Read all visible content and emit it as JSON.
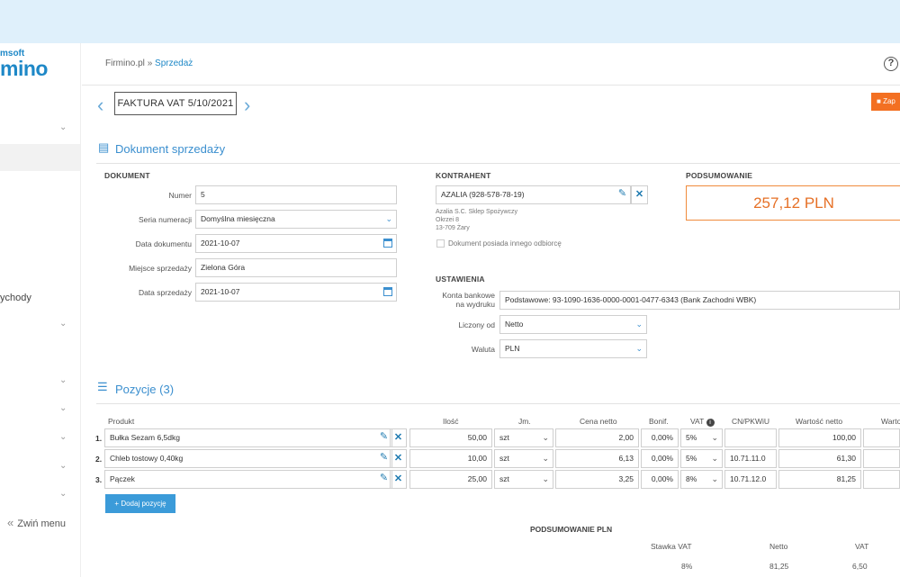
{
  "brand": {
    "small": "msoft",
    "big": "mino"
  },
  "sidebar": {
    "collapse_label": "Zwiń menu",
    "visible_label": "ychody",
    "collapse_icon": "double-chevron-left-icon"
  },
  "breadcrumb": {
    "home": "Firmino.pl",
    "sep": "»",
    "current": "Sprzedaż"
  },
  "help": "?",
  "document": {
    "title": "FAKTURA VAT 5/10/2021",
    "save_label": "Zap"
  },
  "section_doc": {
    "title": "Dokument sprzedaży"
  },
  "dokument": {
    "heading": "DOKUMENT",
    "fields": [
      {
        "label": "Numer",
        "value": "5"
      },
      {
        "label": "Seria numeracji",
        "value": "Domyślna miesięczna"
      },
      {
        "label": "Data dokumentu",
        "value": "2021-10-07"
      },
      {
        "label": "Miejsce sprzedaży",
        "value": "Zielona Góra"
      },
      {
        "label": "Data sprzedaży",
        "value": "2021-10-07"
      }
    ]
  },
  "kontrahent": {
    "heading": "KONTRAHENT",
    "value": "AZALIA (928-578-78-19)",
    "address": [
      "Azalia S.C. Sklep Spożywczy",
      "Okrzei 8",
      "13-709 Żary"
    ],
    "other_recipient": "Dokument posiada innego odbiorcę"
  },
  "ustawienia": {
    "heading": "USTAWIENIA",
    "bank_label_1": "Konta bankowe",
    "bank_label_2": "na wydruku",
    "bank_value": "Podstawowe: 93-1090-1636-0000-0001-0477-6343 (Bank Zachodni WBK)",
    "liczony_label": "Liczony od",
    "liczony_value": "Netto",
    "waluta_label": "Waluta",
    "waluta_value": "PLN"
  },
  "podsumowanie": {
    "heading": "PODSUMOWANIE",
    "total": "257,12 PLN"
  },
  "pozycje": {
    "title": "Pozycje (3)",
    "headers": {
      "produkt": "Produkt",
      "ilosc": "Ilość",
      "jm": "Jm.",
      "cena": "Cena netto",
      "bonif": "Bonif.",
      "vat": "VAT",
      "cn": "CN/PKWiU",
      "wartosc": "Wartość netto",
      "wartosc2": "Warto"
    },
    "rows": [
      {
        "num": "1.",
        "produkt": "Bułka Sezam 6,5dkg",
        "ilosc": "50,00",
        "jm": "szt",
        "cena": "2,00",
        "bonif": "0,00%",
        "vat": "5%",
        "cn": "",
        "wartosc": "100,00"
      },
      {
        "num": "2.",
        "produkt": "Chleb tostowy 0,40kg",
        "ilosc": "10,00",
        "jm": "szt",
        "cena": "6,13",
        "bonif": "0,00%",
        "vat": "5%",
        "cn": "10.71.11.0",
        "wartosc": "61,30"
      },
      {
        "num": "3.",
        "produkt": "Pączek",
        "ilosc": "25,00",
        "jm": "szt",
        "cena": "3,25",
        "bonif": "0,00%",
        "vat": "8%",
        "cn": "10.71.12.0",
        "wartosc": "81,25"
      }
    ],
    "add_label": "Dodaj pozycję"
  },
  "summary_pln": {
    "heading": "PODSUMOWANIE PLN",
    "col_stawka": "Stawka VAT",
    "col_netto": "Netto",
    "col_vat": "VAT",
    "row": {
      "stawka": "8%",
      "netto": "81,25",
      "vat": "6,50"
    }
  },
  "colors": {
    "accent": "#1e88c7",
    "orange": "#f37022",
    "topband": "#dff0fb"
  }
}
